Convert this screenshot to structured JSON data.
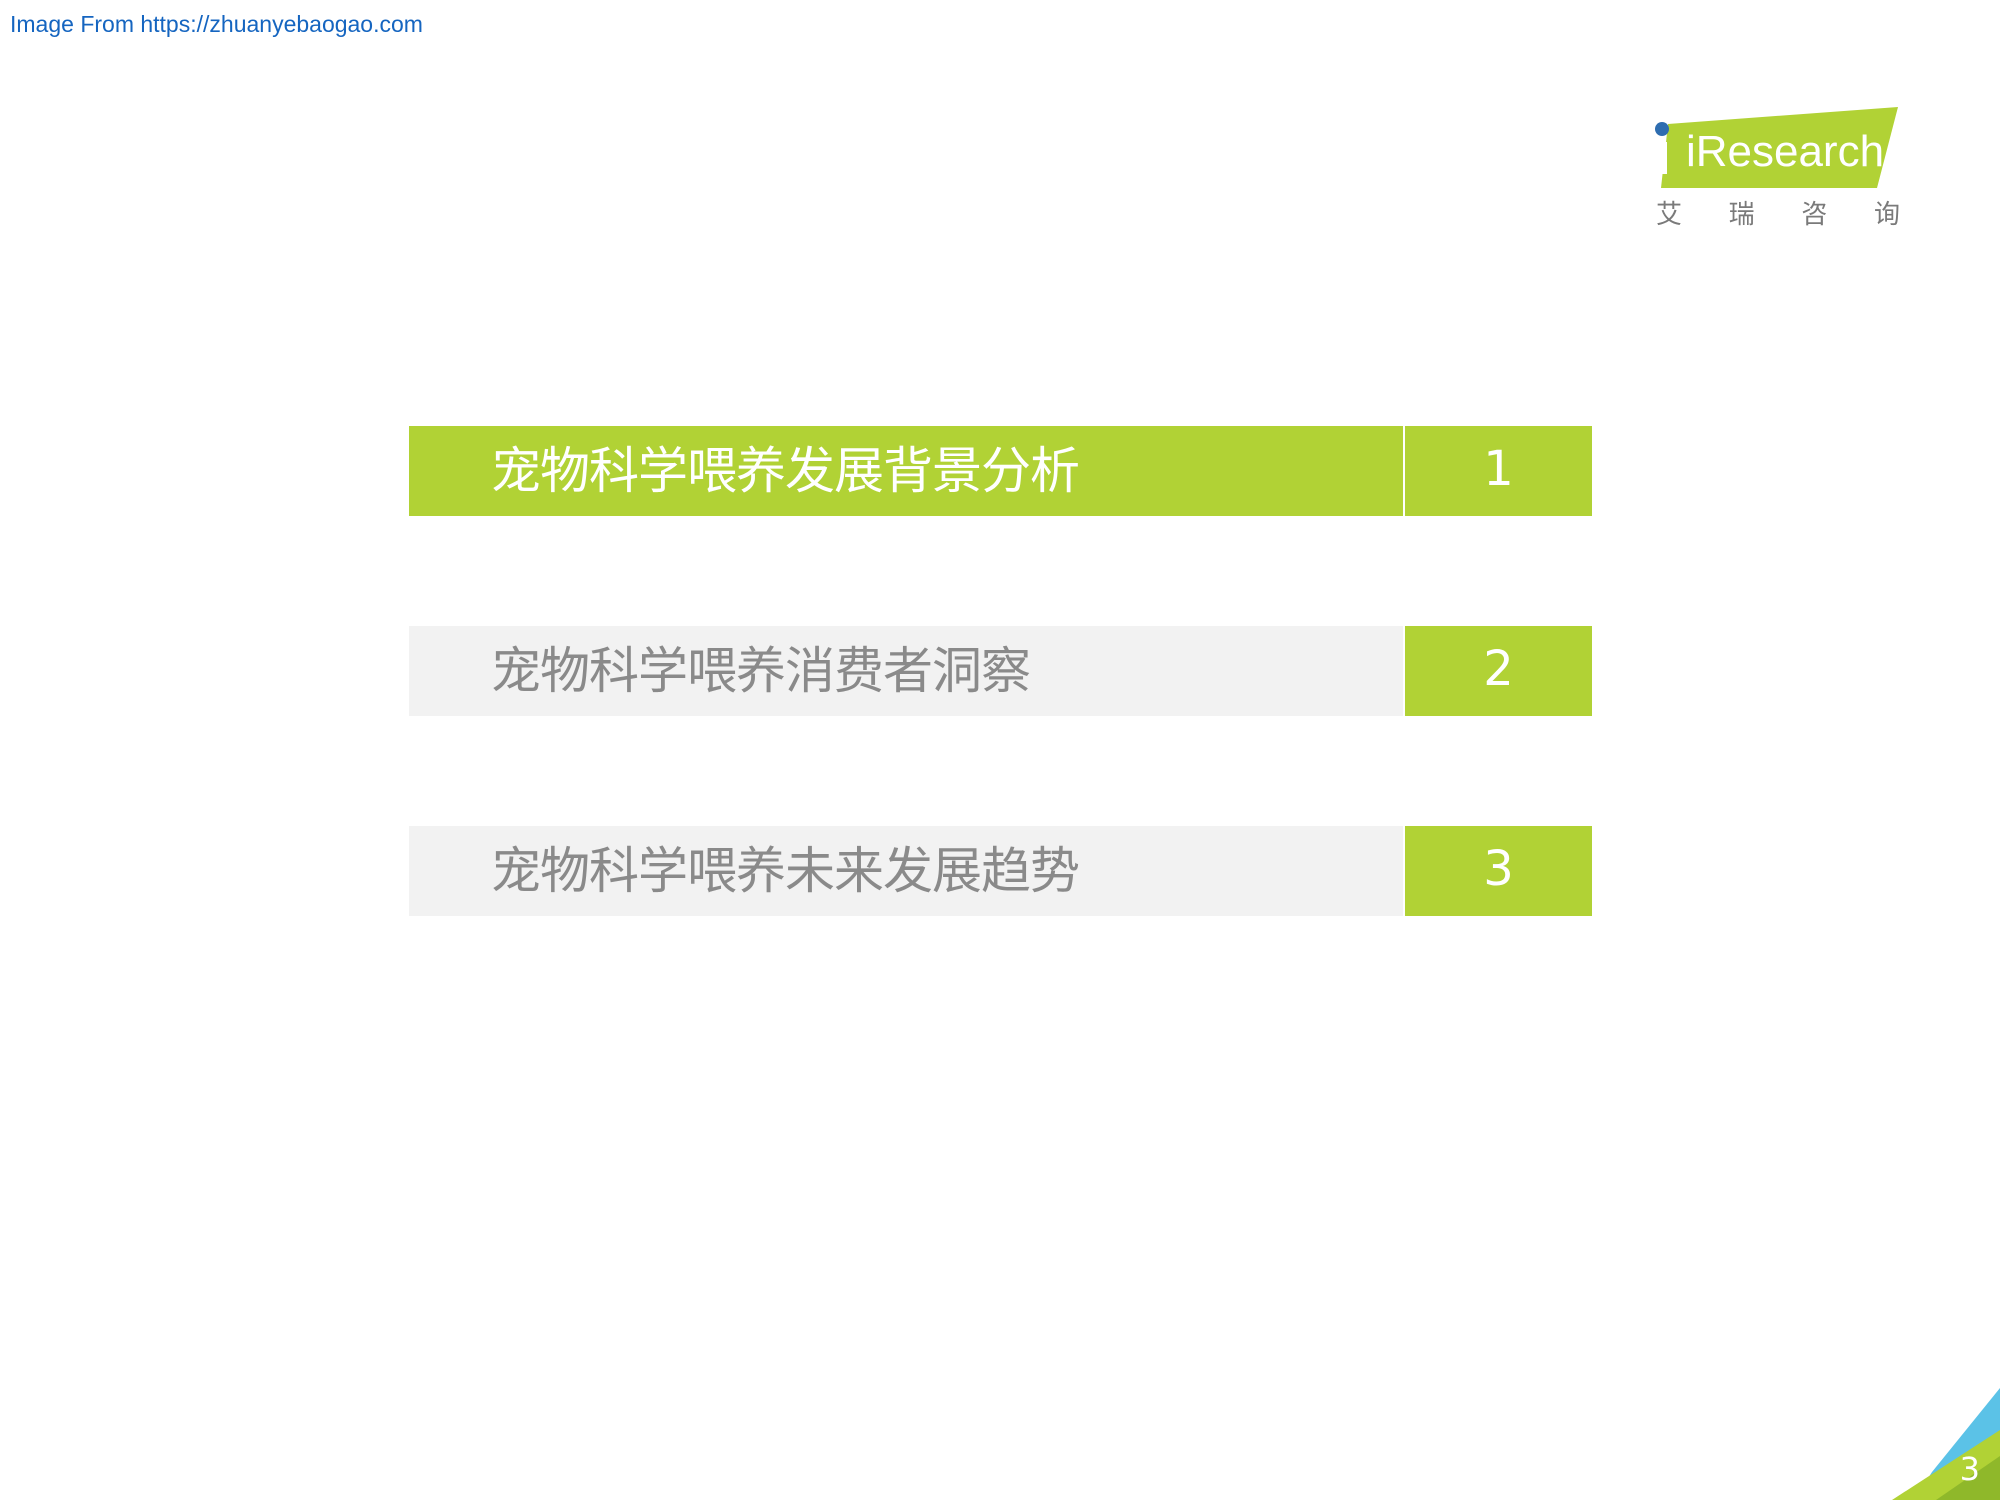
{
  "header": {
    "source_text": "Image From https://zhuanyebaogao.com"
  },
  "logo": {
    "brand": "iResearch",
    "chinese_chars": [
      "艾",
      "瑞",
      "咨",
      "询"
    ],
    "accent_color": "#b1d235",
    "dot_color": "#2e6db0"
  },
  "toc": {
    "items": [
      {
        "title": "宠物科学喂养发展背景分析",
        "number": "1",
        "active": true
      },
      {
        "title": "宠物科学喂养消费者洞察",
        "number": "2",
        "active": false
      },
      {
        "title": "宠物科学喂养未来发展趋势",
        "number": "3",
        "active": false
      }
    ],
    "colors": {
      "accent": "#b1d235",
      "inactive_background": "#f2f2f2",
      "inactive_text": "#8a8a8a",
      "active_text": "#ffffff"
    }
  },
  "footer": {
    "page_number": "3",
    "corner_colors": [
      "#b1d235",
      "#5bc2e7"
    ]
  }
}
